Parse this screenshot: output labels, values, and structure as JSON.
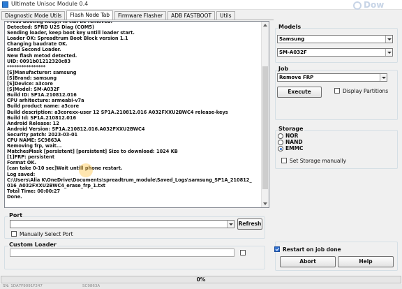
{
  "window": {
    "title": "Ultimate Unisoc Module 0.4",
    "bg_logo": "Dow"
  },
  "tabs": [
    {
      "label": "Diagnostic Mode Utils",
      "active": false
    },
    {
      "label": "Flash Node Tab",
      "active": true
    },
    {
      "label": "Firmware Flasher",
      "active": false
    },
    {
      "label": "ADB FASTBOOT",
      "active": false
    },
    {
      "label": "Utils",
      "active": false
    }
  ],
  "log": {
    "lines": [
      "Press Booting Keep/Pin can be removed.",
      "Detected: SPRD U2S Diag (COM5)",
      "Sending loader, keep boot key untill loader start.",
      "Loader OK: Spreadtrum Boot Block version 1.1",
      "Changing baudrate OK.",
      "Send Second Loader.",
      "New flash metod detected.",
      "UID: 0091b01212320c83",
      "****************",
      "[S]Manufacturer: samsung",
      "[S]Brand: samsung",
      "[S]Device: a3core",
      "[S]Model: SM-A032F",
      "Build ID: SP1A.210812.016",
      "CPU arhitecture: armeabi-v7a",
      "Build product name: a3core",
      "Build description: a3corexx-user 12 SP1A.210812.016 A032FXXU2BWC4 release-keys",
      "Build Id: SP1A.210812.016",
      "Android Release: 12",
      "Android Version: SP1A.210812.016.A032FXXU2BWC4",
      "Security patch: 2023-03-01",
      "CPU NAME: SC9863A",
      "Removing frp, wait...",
      "MatchesMask [persistent] [persistent] Size to download: 1024 KB",
      "[1]FRP: persistent",
      "Format OK.",
      "[can take 0-10 sec]Wait untill phone restart.",
      "Log saved:",
      "C:\\Users\\Alia K\\OneDrive\\Documents\\spreadtrum_module\\Saved_Logs\\samsung_SP1A_210812_",
      "016_A032FXXU2BWC4_erase_frp_1.txt",
      "Total Time: 00:00:27",
      "Done."
    ]
  },
  "models": {
    "title": "Models",
    "brand": "Samsung",
    "model": "SM-A032F"
  },
  "job": {
    "title": "Job",
    "selected": "Remove FRP",
    "execute_label": "Execute",
    "display_partitions_label": "Display Partitions",
    "display_partitions_checked": false
  },
  "storage": {
    "title": "Storage",
    "options": [
      {
        "label": "NOR",
        "checked": false
      },
      {
        "label": "NAND",
        "checked": false
      },
      {
        "label": "EMMC",
        "checked": true
      }
    ],
    "set_manually_label": "Set Storage manually",
    "set_manually_checked": false
  },
  "port": {
    "title": "Port",
    "value": "",
    "refresh_label": "Refresh",
    "manual_label": "Manually Select Port",
    "manual_checked": false
  },
  "custom_loader": {
    "title": "Custom Loader",
    "value": "",
    "checked": false
  },
  "restart_on_done": {
    "label": "Restart on job done",
    "checked": true
  },
  "buttons": {
    "abort": "Abort",
    "help": "Help"
  },
  "progress": {
    "text": "0%",
    "value": 0
  },
  "statusbar": {
    "left": "SN: 1DA7F9091F247",
    "right": "SC9863A"
  },
  "colors": {
    "progress_fill": "#06b025",
    "checkbox_checked": "#2f6fd0"
  }
}
